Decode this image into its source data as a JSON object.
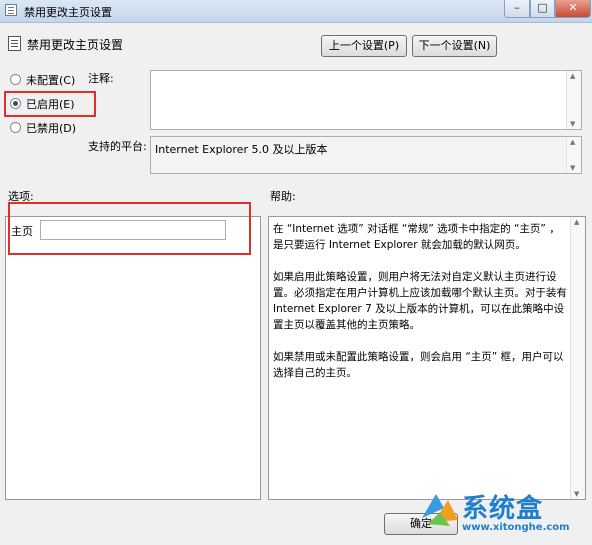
{
  "window": {
    "title": "禁用更改主页设置"
  },
  "header": {
    "policy_title": "禁用更改主页设置",
    "prev_button": "上一个设置(P)",
    "next_button": "下一个设置(N)"
  },
  "state": {
    "options": [
      {
        "label": "未配置(C)",
        "selected": false
      },
      {
        "label": "已启用(E)",
        "selected": true
      },
      {
        "label": "已禁用(D)",
        "selected": false
      }
    ]
  },
  "comment": {
    "label": "注释:",
    "value": ""
  },
  "platform": {
    "label": "支持的平台:",
    "value": "Internet Explorer 5.0 及以上版本"
  },
  "options_panel": {
    "label": "选项:",
    "homepage_label": "主页",
    "homepage_value": ""
  },
  "help_panel": {
    "label": "帮助:",
    "text": "在 “Internet 选项” 对话框 “常规” 选项卡中指定的 “主页” ，是只要运行 Internet Explorer 就会加载的默认网页。\n\n如果启用此策略设置，则用户将无法对自定义默认主页进行设置。必须指定在用户计算机上应该加载哪个默认主页。对于装有 Internet Explorer 7 及以上版本的计算机，可以在此策略中设置主页以覆盖其他的主页策略。\n\n如果禁用或未配置此策略设置，则会启用 “主页” 框，用户可以选择自己的主页。"
  },
  "footer": {
    "ok_button": "确定"
  },
  "watermark": {
    "brand": "系统盒",
    "url": "www.xitonghe.com"
  },
  "colors": {
    "highlight": "#e0302b",
    "watermark": "#1e7fcf"
  }
}
